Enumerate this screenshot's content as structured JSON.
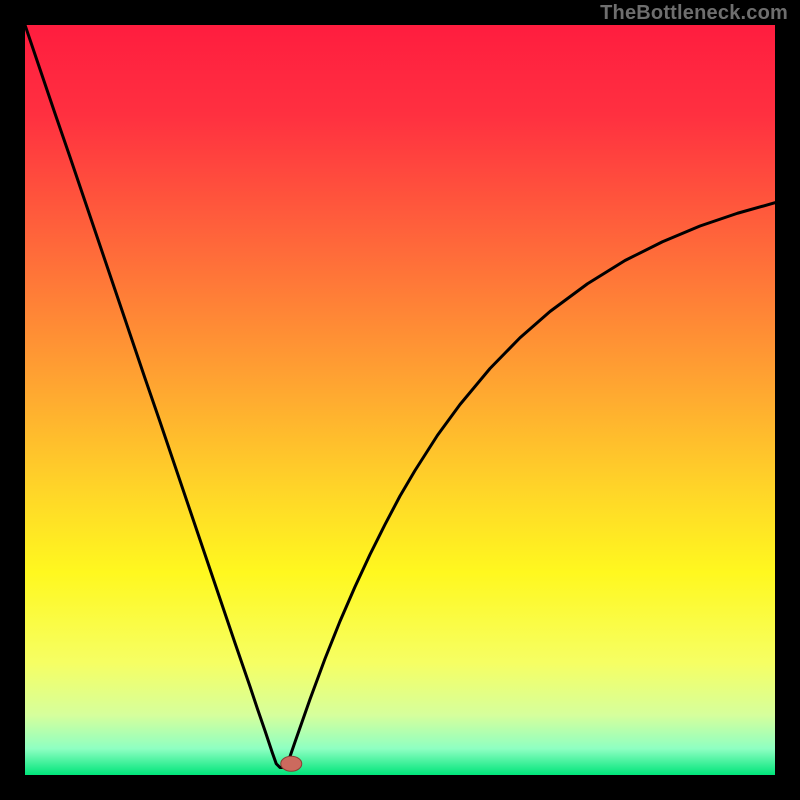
{
  "watermark": "TheBottleneck.com",
  "colors": {
    "frame": "#000000",
    "gradient_stops": [
      {
        "offset": 0.0,
        "color": "#ff1d3f"
      },
      {
        "offset": 0.12,
        "color": "#ff3040"
      },
      {
        "offset": 0.3,
        "color": "#ff6a3a"
      },
      {
        "offset": 0.48,
        "color": "#ffa531"
      },
      {
        "offset": 0.62,
        "color": "#ffd528"
      },
      {
        "offset": 0.73,
        "color": "#fff81f"
      },
      {
        "offset": 0.85,
        "color": "#f6ff63"
      },
      {
        "offset": 0.92,
        "color": "#d6ff9c"
      },
      {
        "offset": 0.965,
        "color": "#8effc2"
      },
      {
        "offset": 1.0,
        "color": "#00e57a"
      }
    ],
    "curve": "#000000",
    "marker_fill": "#cc6a5e",
    "marker_stroke": "#8a3d34"
  },
  "chart_data": {
    "type": "line",
    "title": "",
    "xlabel": "",
    "ylabel": "",
    "xlim": [
      0,
      100
    ],
    "ylim": [
      0,
      100
    ],
    "grid": false,
    "legend": false,
    "notch_x": 34,
    "marker": {
      "x": 35.5,
      "y": 1.5,
      "rx": 1.4,
      "ry": 1.0
    },
    "series": [
      {
        "name": "curve",
        "x": [
          0,
          2,
          4,
          6,
          8,
          10,
          12,
          14,
          16,
          18,
          20,
          22,
          24,
          26,
          28,
          30,
          31,
          32,
          33,
          33.5,
          34,
          34.5,
          35,
          36,
          38,
          40,
          42,
          44,
          46,
          48,
          50,
          52,
          55,
          58,
          62,
          66,
          70,
          75,
          80,
          85,
          90,
          95,
          100
        ],
        "y": [
          100,
          94.1,
          88.2,
          82.4,
          76.5,
          70.6,
          64.7,
          58.8,
          52.9,
          47.1,
          41.2,
          35.3,
          29.4,
          23.5,
          17.6,
          11.8,
          8.8,
          5.9,
          2.9,
          1.5,
          1.0,
          1.0,
          1.5,
          4.4,
          10.1,
          15.5,
          20.5,
          25.1,
          29.4,
          33.4,
          37.2,
          40.6,
          45.3,
          49.4,
          54.2,
          58.3,
          61.8,
          65.5,
          68.6,
          71.1,
          73.2,
          74.9,
          76.3
        ]
      }
    ]
  }
}
